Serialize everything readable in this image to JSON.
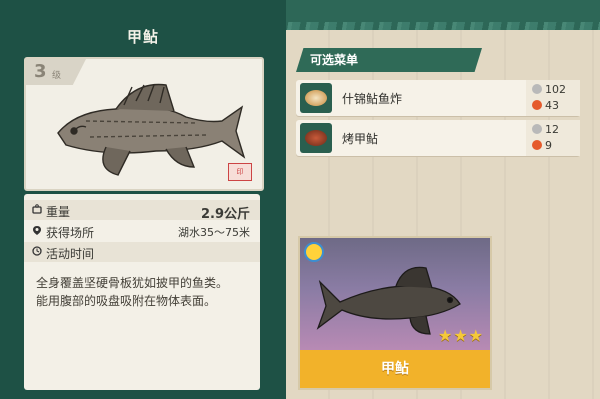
{
  "fish": {
    "name": "甲鲇",
    "level": "3",
    "level_unit": "级",
    "weight_label": "重量",
    "weight_value": "2.9公斤",
    "location_label": "获得场所",
    "location_value": "湖水35～75米",
    "activity_label": "活动时间",
    "description_line1": "全身覆盖坚硬骨板犹如披甲的鱼类。",
    "description_line2": "能用腹部的吸盘吸附在物体表面。",
    "stars": 3,
    "stars_max": 3
  },
  "menu": {
    "header": "可选菜单",
    "dishes": [
      {
        "name": "什锦鲇鱼炸",
        "stat1": "102",
        "stat2": "43",
        "icon": "fried-fish-dish-icon"
      },
      {
        "name": "烤甲鲇",
        "stat1": "12",
        "stat2": "9",
        "icon": "grilled-fish-dish-icon"
      }
    ]
  },
  "preview": {
    "label": "甲鲇",
    "stars_text": "★★★"
  },
  "colors": {
    "panel_green": "#1e5145",
    "accent_gold": "#f2b22a",
    "card_bg": "#f3f0e7"
  }
}
